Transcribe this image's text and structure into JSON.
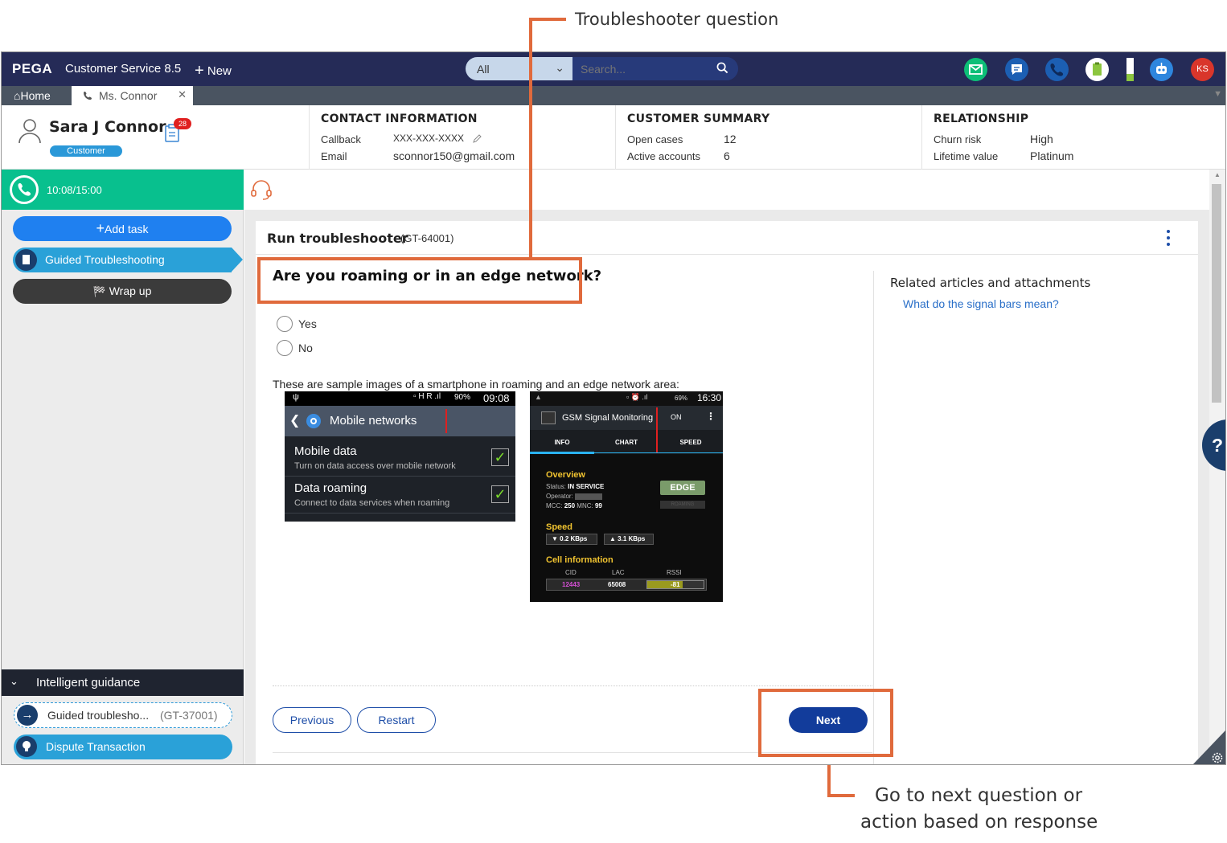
{
  "annotations": {
    "question_callout": "Troubleshooter question",
    "next_callout_line1": "Go to next question or",
    "next_callout_line2": "action based on response"
  },
  "header": {
    "brand": "PEGA",
    "app_name": "Customer Service 8.5",
    "new_label": "New",
    "search_scope": "All",
    "search_placeholder": "Search...",
    "user_initials": "KS",
    "colors": {
      "header_bg": "#252b57",
      "email": "#0dbf77",
      "chat": "#1c5fb3",
      "phone": "#1c5fb3",
      "avatar": "#d9362b"
    }
  },
  "tabs": {
    "home": "Home",
    "active": "Ms. Connor"
  },
  "customer": {
    "name": "Sara J Connor",
    "badge": "Customer",
    "notifications": "28",
    "contact": {
      "title": "CONTACT INFORMATION",
      "callback_label": "Callback",
      "callback_value": "XXX-XXX-XXXX",
      "email_label": "Email",
      "email_value": "sconnor150@gmail.com"
    },
    "summary": {
      "title": "CUSTOMER SUMMARY",
      "open_cases_label": "Open cases",
      "open_cases_value": "12",
      "active_accounts_label": "Active accounts",
      "active_accounts_value": "6"
    },
    "relationship": {
      "title": "RELATIONSHIP",
      "churn_label": "Churn risk",
      "churn_value": "High",
      "lifetime_label": "Lifetime value",
      "lifetime_value": "Platinum"
    }
  },
  "left": {
    "timer": "10:08/15:00",
    "add_task": "Add task",
    "guided": "Guided Troubleshooting",
    "wrap_up": "Wrap up",
    "guidance_title": "Intelligent guidance",
    "guidance_item1": "Guided troublesho...",
    "guidance_item1_id": "(GT-37001)",
    "guidance_item2": "Dispute Transaction"
  },
  "main": {
    "title": "Run troubleshooter",
    "case_id": "(GT-64001)",
    "question": "Are you roaming or in an edge network?",
    "options": [
      "Yes",
      "No"
    ],
    "sample_text": "These are sample images of a smartphone in roaming and an edge network area:",
    "related_title": "Related articles and attachments",
    "related_link": "What do the signal bars mean?",
    "previous": "Previous",
    "restart": "Restart",
    "next": "Next"
  },
  "phone1": {
    "battery": "90%",
    "time": "09:08",
    "title": "Mobile networks",
    "row1_title": "Mobile data",
    "row1_sub": "Turn on data access over mobile network",
    "row2_title": "Data roaming",
    "row2_sub": "Connect to data services when roaming"
  },
  "phone2": {
    "battery": "69%",
    "time": "16:30",
    "app_title": "GSM Signal Monitoring",
    "toggle": "ON",
    "tabs": [
      "INFO",
      "CHART",
      "SPEED"
    ],
    "overview": "Overview",
    "status_label": "Status:",
    "status_value": "IN SERVICE",
    "operator_label": "Operator:",
    "mcc_label": "MCC:",
    "mcc_value": "250",
    "mnc_label": "MNC:",
    "mnc_value": "99",
    "network_type": "EDGE",
    "roaming": "ROAMING",
    "speed": "Speed",
    "speed_down": "0.2 KBps",
    "speed_up": "3.1 KBps",
    "cell_info": "Cell information",
    "cid_label": "CID",
    "lac_label": "LAC",
    "rssi_label": "RSSI",
    "cid_value": "12443",
    "lac_value": "65008",
    "rssi_value": "-81"
  }
}
